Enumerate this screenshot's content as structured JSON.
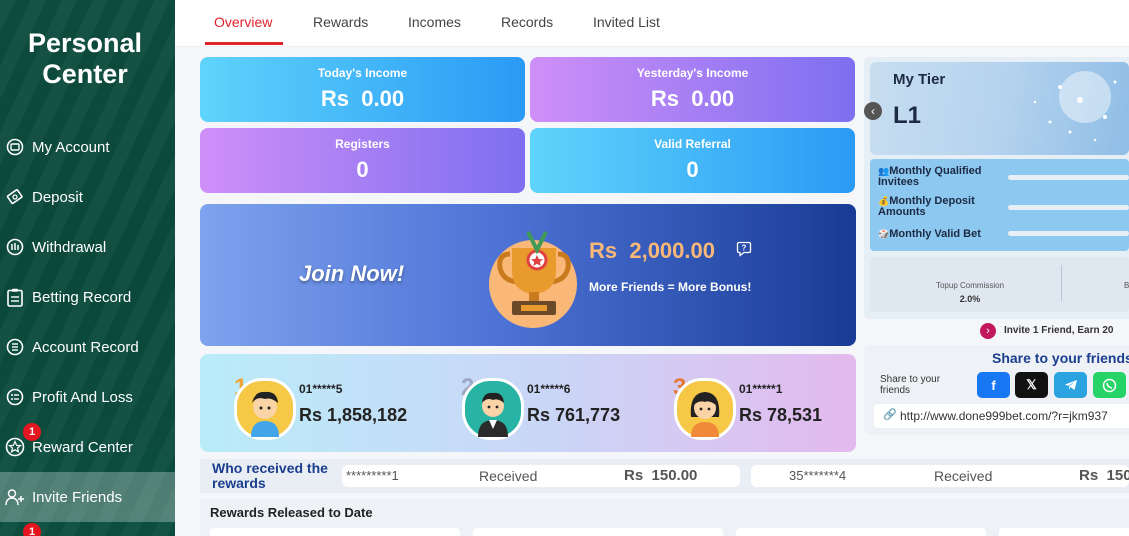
{
  "sidebar": {
    "title_line1": "Personal",
    "title_line2": "Center",
    "items": [
      {
        "label": "My Account"
      },
      {
        "label": "Deposit"
      },
      {
        "label": "Withdrawal"
      },
      {
        "label": "Betting Record"
      },
      {
        "label": "Account Record"
      },
      {
        "label": "Profit And Loss"
      },
      {
        "label": "Reward Center",
        "badge": "1"
      },
      {
        "label": "Invite Friends"
      }
    ],
    "bottom_badge": "1"
  },
  "tabs": [
    "Overview",
    "Rewards",
    "Incomes",
    "Records",
    "Invited List"
  ],
  "stats": {
    "today_label": "Today's Income",
    "today_value": "Rs  0.00",
    "yesterday_label": "Yesterday's Income",
    "yesterday_value": "Rs  0.00",
    "registers_label": "Registers",
    "registers_value": "0",
    "valid_label": "Valid Referral",
    "valid_value": "0"
  },
  "join": {
    "cta": "Join Now!",
    "amount": "Rs  2,000.00",
    "tagline": "More Friends = More Bonus!",
    "help_icon": "question-bubble-icon"
  },
  "leaders": [
    {
      "rank": "1",
      "suffix": "st",
      "name": "01*****5",
      "amount": "Rs 1,858,182"
    },
    {
      "rank": "2",
      "suffix": "nd",
      "name": "01*****6",
      "amount": "Rs 761,773"
    },
    {
      "rank": "3",
      "suffix": "rd",
      "name": "01*****1",
      "amount": "Rs 78,531"
    }
  ],
  "tier": {
    "title": "My Tier",
    "level": "L1",
    "rows": [
      "Monthly Qualified Invitees",
      "Monthly Deposit Amounts",
      "Monthly Valid Bet"
    ],
    "commission_label": "Topup Commission",
    "commission_value": "2.0%",
    "commission_next_label": "B"
  },
  "invite_banner": "Invite 1 Friend, Earn 20",
  "share": {
    "title": "Share to your friends",
    "label": "Share to your friends",
    "link": "http://www.done999bet.com/?r=jkm937"
  },
  "received": {
    "title": "Who received the rewards",
    "entries": [
      {
        "user": "*********1",
        "status": "Received",
        "amount": "Rs  150.00"
      },
      {
        "user": "35*******4",
        "status": "Received",
        "amount": "Rs  150"
      }
    ]
  },
  "released_title": "Rewards Released to Date",
  "colors": {
    "accent": "#e3222b",
    "sidebar": "#0f4d3f"
  }
}
